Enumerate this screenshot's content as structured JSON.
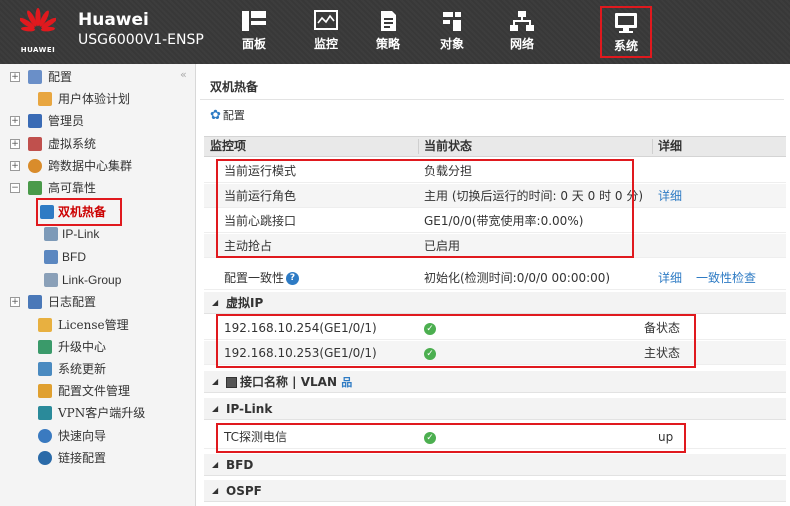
{
  "header": {
    "logo_text": "HUAWEI",
    "brand": "Huawei",
    "device": "USG6000V1-ENSP",
    "nav": [
      {
        "label": "面板",
        "icon": "dashboard-icon"
      },
      {
        "label": "监控",
        "icon": "monitor-icon"
      },
      {
        "label": "策略",
        "icon": "policy-icon"
      },
      {
        "label": "对象",
        "icon": "object-icon"
      },
      {
        "label": "网络",
        "icon": "network-icon"
      },
      {
        "label": "系统",
        "icon": "system-icon",
        "active": true
      }
    ]
  },
  "sidebar": {
    "collapse_glyph": "«",
    "items": [
      {
        "label": "配置",
        "toggle": "+",
        "icon": "config-icon",
        "color": "#6a8fc8"
      },
      {
        "label": "用户体验计划",
        "icon": "user-experience-icon",
        "color": "#e8a640"
      },
      {
        "label": "管理员",
        "toggle": "+",
        "icon": "admin-icon",
        "color": "#3a6bb5"
      },
      {
        "label": "虚拟系统",
        "toggle": "+",
        "icon": "virtual-system-icon",
        "color": "#c0504d"
      },
      {
        "label": "跨数据中心集群",
        "toggle": "+",
        "icon": "cluster-icon",
        "color": "#d98c2b"
      },
      {
        "label": "高可靠性",
        "toggle": "−",
        "icon": "high-reliability-icon",
        "color": "#4a9a4a"
      },
      {
        "label": "双机热备",
        "icon": "hot-standby-icon",
        "color": "#2e7bc4",
        "selected": true
      },
      {
        "label": "IP-Link",
        "icon": "ip-link-icon",
        "color": "#7d9ab8"
      },
      {
        "label": "BFD",
        "icon": "bfd-icon",
        "color": "#5b87c0"
      },
      {
        "label": "Link-Group",
        "icon": "link-group-icon",
        "color": "#8aa0b8"
      },
      {
        "label": "日志配置",
        "toggle": "+",
        "icon": "log-config-icon",
        "color": "#4a78b8"
      },
      {
        "label": "License管理",
        "icon": "license-icon",
        "color": "#e8b040"
      },
      {
        "label": "升级中心",
        "icon": "upgrade-center-icon",
        "color": "#3a9a6a"
      },
      {
        "label": "系统更新",
        "icon": "system-update-icon",
        "color": "#4a8ac0"
      },
      {
        "label": "配置文件管理",
        "icon": "config-file-icon",
        "color": "#e0a030"
      },
      {
        "label": "VPN客户端升级",
        "icon": "vpn-client-icon",
        "color": "#2a8a9a"
      },
      {
        "label": "快速向导",
        "icon": "quick-wizard-icon",
        "color": "#3a7ac0"
      },
      {
        "label": "链接配置",
        "icon": "link-config-icon",
        "color": "#2a6aa8"
      }
    ]
  },
  "main": {
    "breadcrumb": "双机热备",
    "config_link": "配置",
    "headers": [
      "监控项",
      "当前状态",
      "详细"
    ],
    "status_rows": [
      {
        "item": "当前运行模式",
        "status": "负载分担",
        "detail": ""
      },
      {
        "item": "当前运行角色",
        "status": "主用 (切换后运行的时间: 0 天 0 时 0 分)",
        "detail": "详细"
      },
      {
        "item": "当前心跳接口",
        "status": "GE1/0/0(带宽使用率:0.00%)",
        "detail": ""
      },
      {
        "item": "主动抢占",
        "status": "已启用",
        "detail": ""
      },
      {
        "item": "配置一致性",
        "status": "初始化(检测时间:0/0/0 00:00:00)",
        "detail": "详细",
        "detail2": "一致性检查"
      }
    ],
    "sections": {
      "vip": "虚拟IP",
      "iface": "接口名称 | VLAN",
      "iplink": "IP-Link",
      "bfd": "BFD",
      "ospf": "OSPF"
    },
    "vip_rows": [
      {
        "ip": "192.168.10.254(GE1/0/1)",
        "state": "备状态"
      },
      {
        "ip": "192.168.10.253(GE1/0/1)",
        "state": "主状态"
      }
    ],
    "iplink_rows": [
      {
        "name": "TC探测电信",
        "state": "up"
      }
    ]
  }
}
